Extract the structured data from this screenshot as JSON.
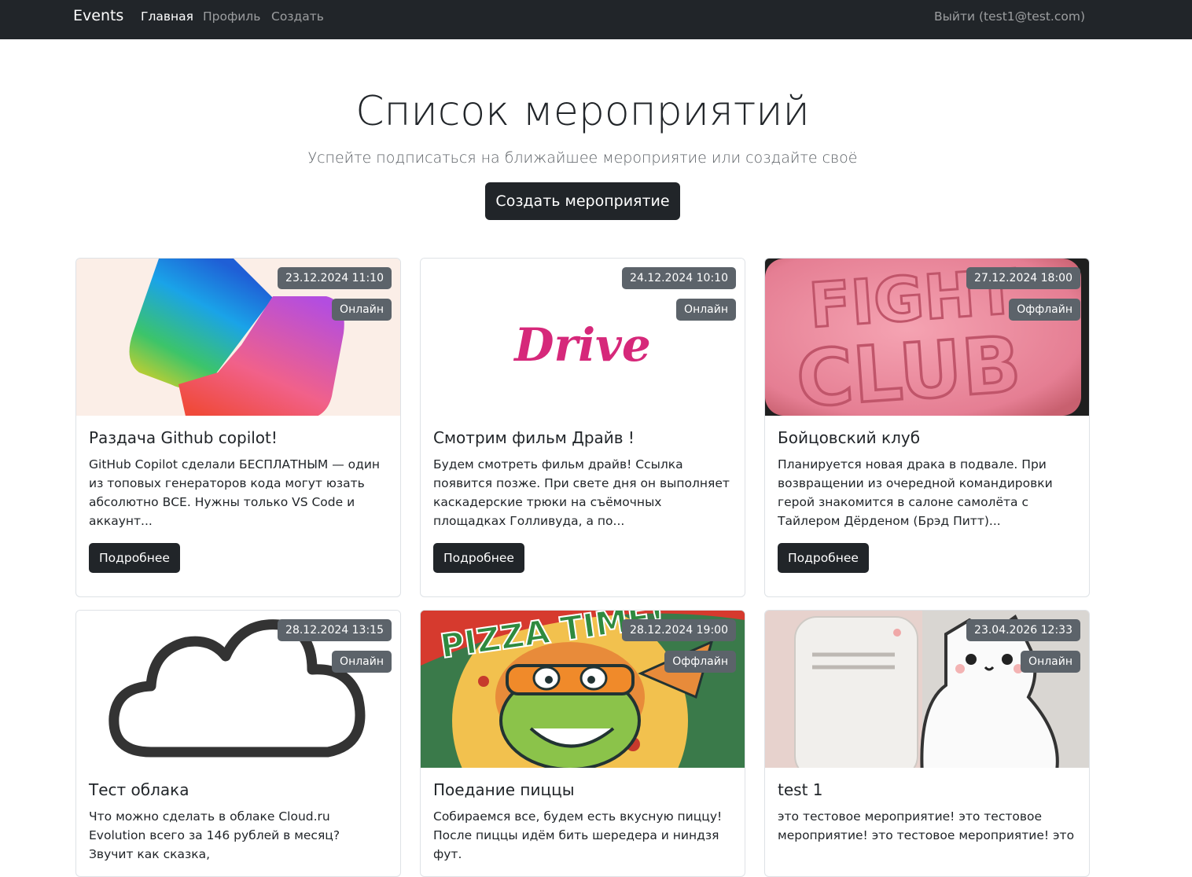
{
  "nav": {
    "brand": "Events",
    "links": [
      "Главная",
      "Профиль",
      "Создать"
    ],
    "logout": "Выйти (test1@test.com)"
  },
  "hero": {
    "title": "Список мероприятий",
    "subtitle": "Успейте подписаться на ближайшее мероприятие или создайте своё",
    "create_button": "Создать мероприятие"
  },
  "more_label": "Подробнее",
  "events": [
    {
      "title": "Раздача Github copilot!",
      "text": "GitHub Copilot сделали БЕСПЛАТНЫМ — один из топовых генераторов кода могут юзать абсолютно ВСЕ. Нужны только VS Code и аккаунт...",
      "date": "23.12.2024 11:10",
      "mode": "Онлайн",
      "image": "copilot-logo"
    },
    {
      "title": "Смотрим фильм Драйв !",
      "text": "Будем смотреть фильм драйв! Ссылка появится позже. При свете дня он выполняет каскадерские трюки на съёмочных площадках Голливуда, а по...",
      "date": "24.12.2024 10:10",
      "mode": "Онлайн",
      "image": "drive-logo",
      "image_text": "Drive"
    },
    {
      "title": "Бойцовский клуб",
      "text": "Планируется новая драка в подвале. При возвращении из очередной командировки герой знакомится в салоне самолёта с Тайлером Дёрденом (Брэд Питт)...",
      "date": "27.12.2024 18:00",
      "mode": "Оффлайн",
      "image": "fight-club-soap",
      "image_text": [
        "FIGHT",
        "CLUB"
      ]
    },
    {
      "title": "Тест облака",
      "text": "Что можно сделать в облаке Cloud.ru Evolution всего за 146 рублей в месяц? Звучит как сказка,",
      "date": "28.12.2024 13:15",
      "mode": "Онлайн",
      "image": "cloud-icon"
    },
    {
      "title": "Поедание пиццы",
      "text": "Собираемся все, будем есть вкусную пиццу! После пиццы идём бить шередера и ниндзя фут.",
      "date": "28.12.2024 19:00",
      "mode": "Оффлайн",
      "image": "ninja-turtle-pizza",
      "image_text": "PIZZA TIME!"
    },
    {
      "title": "test 1",
      "text": "это тестовое мероприятие! это тестовое мероприятие! это тестовое мероприятие! это",
      "date": "23.04.2026 12:33",
      "mode": "Онлайн",
      "image": "cat-illustration"
    }
  ]
}
